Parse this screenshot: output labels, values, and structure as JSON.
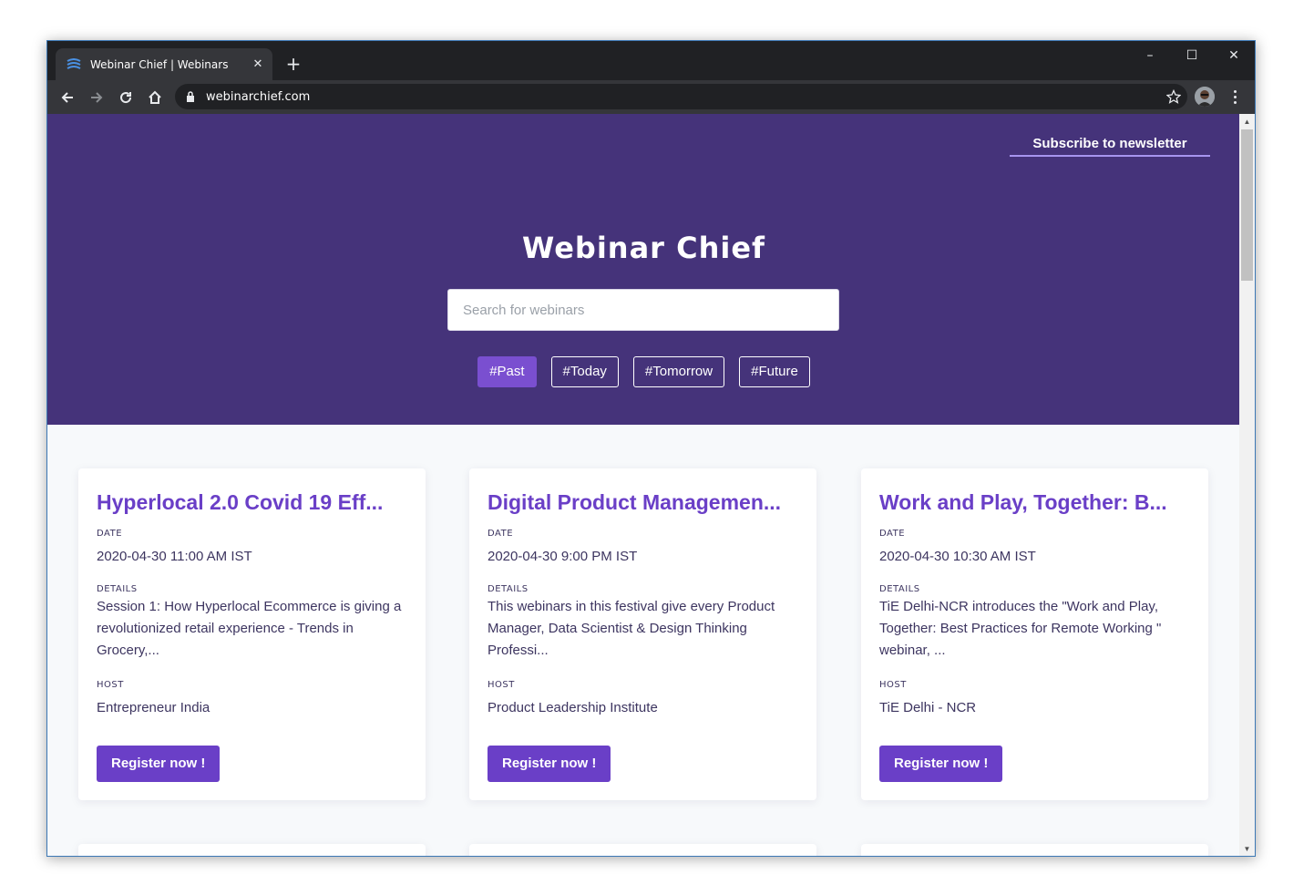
{
  "browser": {
    "tab_title": "Webinar Chief | Webinars",
    "new_tab_label": "+",
    "url": "webinarchief.com",
    "window_controls": {
      "minimize": "–",
      "maximize": "☐",
      "close": "✕"
    },
    "icons": [
      "back-icon",
      "forward-icon",
      "reload-icon",
      "home-icon",
      "lock-icon",
      "star-icon",
      "menu-icon"
    ]
  },
  "header": {
    "subscribe_label": "Subscribe to newsletter",
    "site_title": "Webinar Chief",
    "search_placeholder": "Search for webinars",
    "filters": [
      {
        "label": "#Past",
        "active": true
      },
      {
        "label": "#Today",
        "active": false
      },
      {
        "label": "#Tomorrow",
        "active": false
      },
      {
        "label": "#Future",
        "active": false
      }
    ]
  },
  "labels": {
    "date": "DATE",
    "details": "DETAILS",
    "host": "HOST",
    "register": "Register now !"
  },
  "webinars": [
    {
      "title": "Hyperlocal 2.0 Covid 19 Eff...",
      "date": "2020-04-30 11:00 AM IST",
      "details": "Session 1: How Hyperlocal Ecommerce is giving a revolutionized retail experience - Trends in Grocery,...",
      "host": "Entrepreneur India"
    },
    {
      "title": "Digital Product Managemen...",
      "date": "2020-04-30 9:00 PM IST",
      "details": "This webinars in this festival give every Product Manager, Data Scientist & Design Thinking Professi...",
      "host": "Product Leadership Institute"
    },
    {
      "title": "Work and Play, Together: B...",
      "date": "2020-04-30 10:30 AM IST",
      "details": "TiE Delhi-NCR introduces the \"Work and Play, Together: Best Practices for Remote Working \" webinar, ...",
      "host": "TiE Delhi - NCR"
    }
  ],
  "colors": {
    "hero_bg": "#45337a",
    "accent": "#6a3fc7",
    "active_tag": "#7a4fd0",
    "page_bg": "#f7f9fb"
  }
}
